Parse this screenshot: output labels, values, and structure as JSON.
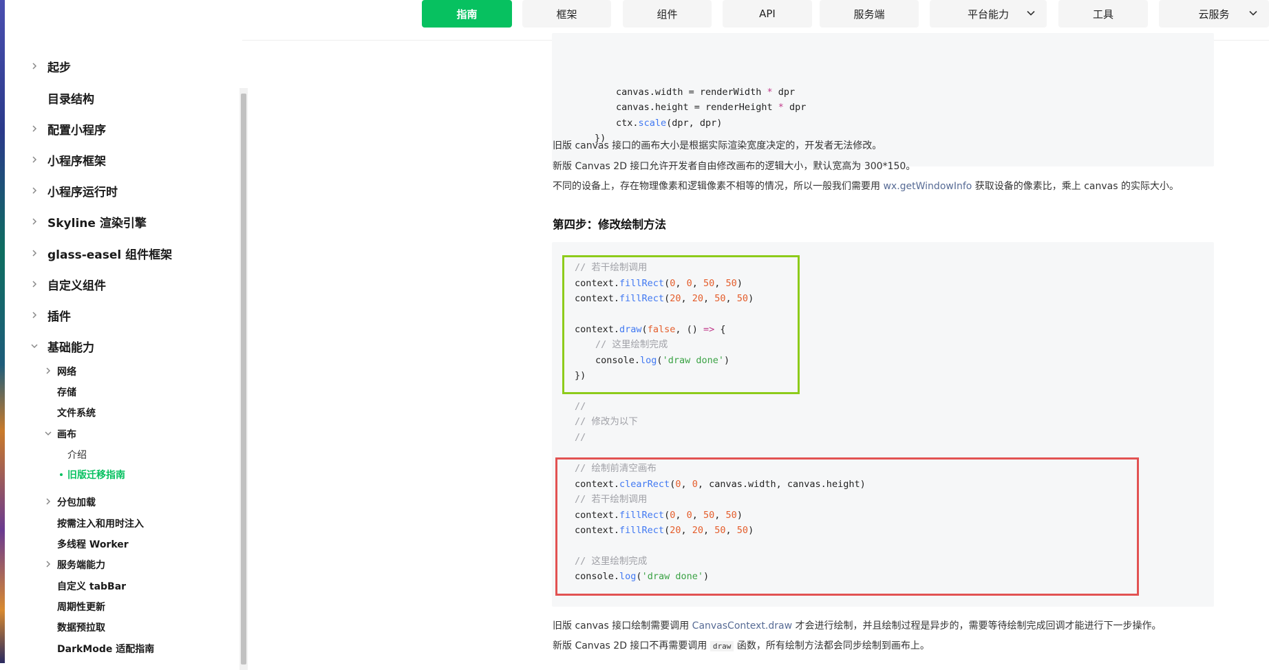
{
  "nav": {
    "items": [
      {
        "label": "指南",
        "active": true
      },
      {
        "label": "框架"
      },
      {
        "label": "组件"
      },
      {
        "label": "API"
      },
      {
        "label": "服务端"
      },
      {
        "label": "平台能力",
        "dropdown": true
      },
      {
        "label": "工具"
      },
      {
        "label": "云服务",
        "dropdown": true
      }
    ],
    "accent": "#07c160"
  },
  "sidebar": {
    "items": [
      {
        "label": "起步",
        "caret": "right"
      },
      {
        "label": "目录结构"
      },
      {
        "label": "配置小程序",
        "caret": "right"
      },
      {
        "label": "小程序框架",
        "caret": "right"
      },
      {
        "label": "小程序运行时",
        "caret": "right"
      },
      {
        "label": "Skyline 渲染引擎",
        "caret": "right"
      },
      {
        "label": "glass-easel 组件框架",
        "caret": "right"
      },
      {
        "label": "自定义组件",
        "caret": "right"
      },
      {
        "label": "插件",
        "caret": "right"
      },
      {
        "label": "基础能力",
        "caret": "down"
      }
    ],
    "sub": [
      {
        "label": "网络",
        "caret": "right"
      },
      {
        "label": "存储"
      },
      {
        "label": "文件系统"
      },
      {
        "label": "画布",
        "caret": "down"
      },
      {
        "label": "介绍",
        "level": 3
      },
      {
        "label": "旧版迁移指南",
        "level": 3,
        "active": true
      },
      {
        "label": "分包加载",
        "caret": "right"
      },
      {
        "label": "按需注入和用时注入"
      },
      {
        "label": "多线程 Worker"
      },
      {
        "label": "服务端能力",
        "caret": "right"
      },
      {
        "label": "自定义 tabBar"
      },
      {
        "label": "周期性更新"
      },
      {
        "label": "数据预拉取"
      },
      {
        "label": "DarkMode 适配指南"
      }
    ]
  },
  "content": {
    "code1": [
      "canvas.width = renderWidth * dpr",
      "canvas.height = renderHeight * dpr",
      "ctx.scale(dpr, dpr)",
      "})"
    ],
    "p1": "旧版 canvas 接口的画布大小是根据实际渲染宽度决定的，开发者无法修改。",
    "p2": "新版 Canvas 2D 接口允许开发者自由修改画布的逻辑大小，默认宽高为 300*150。",
    "p3_a": "不同的设备上，存在物理像素和逻辑像素不相等的情况，所以一般我们需要用 ",
    "p3_link": "wx.getWindowInfo",
    "p3_b": " 获取设备的像素比，乘上 canvas 的实际大小。",
    "heading": "第四步：修改绘制方法",
    "code2": [
      "// 若干绘制调用",
      "context.fillRect(0, 0, 50, 50)",
      "context.fillRect(20, 20, 50, 50)",
      "",
      "context.draw(false, () => {",
      "  // 这里绘制完成",
      "  console.log('draw done')",
      "})",
      "",
      "//",
      "// 修改为以下",
      "//",
      "",
      "// 绘制前清空画布",
      "context.clearRect(0, 0, canvas.width, canvas.height)",
      "// 若干绘制调用",
      "context.fillRect(0, 0, 50, 50)",
      "context.fillRect(20, 20, 50, 50)",
      "",
      "// 这里绘制完成",
      "console.log('draw done')"
    ],
    "p4_a": "旧版 canvas 接口绘制需要调用 ",
    "p4_link": "CanvasContext.draw",
    "p4_b": " 才会进行绘制，并且绘制过程是异步的，需要等待绘制完成回调才能进行下一步操作。",
    "p5_a": "新版 Canvas 2D 接口不再需要调用 ",
    "p5_code": "draw",
    "p5_b": " 函数，所有绘制方法都会同步绘制到画布上。"
  }
}
